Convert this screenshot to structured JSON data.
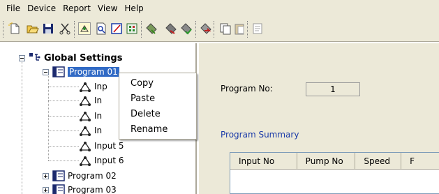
{
  "menubar": {
    "items": [
      "File",
      "Device",
      "Report",
      "View",
      "Help"
    ]
  },
  "toolbar": {
    "icons": [
      "new-file-icon",
      "open-folder-icon",
      "save-icon",
      "cut-icon",
      "connect-icon",
      "preview-icon",
      "edit-icon",
      "settings-icon",
      "upload-icon",
      "download-icon",
      "sync-icon",
      "run-icon",
      "copy-icon",
      "paste-icon",
      "properties-icon"
    ]
  },
  "tree": {
    "root_label": "Global Settings",
    "selected_program": "Program 01",
    "inputs_visible": [
      "Inp",
      "In",
      "In",
      "In",
      "Input 5",
      "Input 6"
    ],
    "collapsed_programs": [
      "Program 02",
      "Program 03"
    ]
  },
  "context_menu": {
    "items": [
      "Copy",
      "Paste",
      "Delete",
      "Rename"
    ]
  },
  "details": {
    "program_no_label": "Program No:",
    "program_no_value": "1",
    "summary_title": "Program Summary",
    "columns": [
      "Input No",
      "Pump No",
      "Speed",
      "F"
    ]
  },
  "colors": {
    "chrome": "#ece9d8",
    "selection": "#316ac5",
    "summary_link": "#1a3aa8"
  }
}
